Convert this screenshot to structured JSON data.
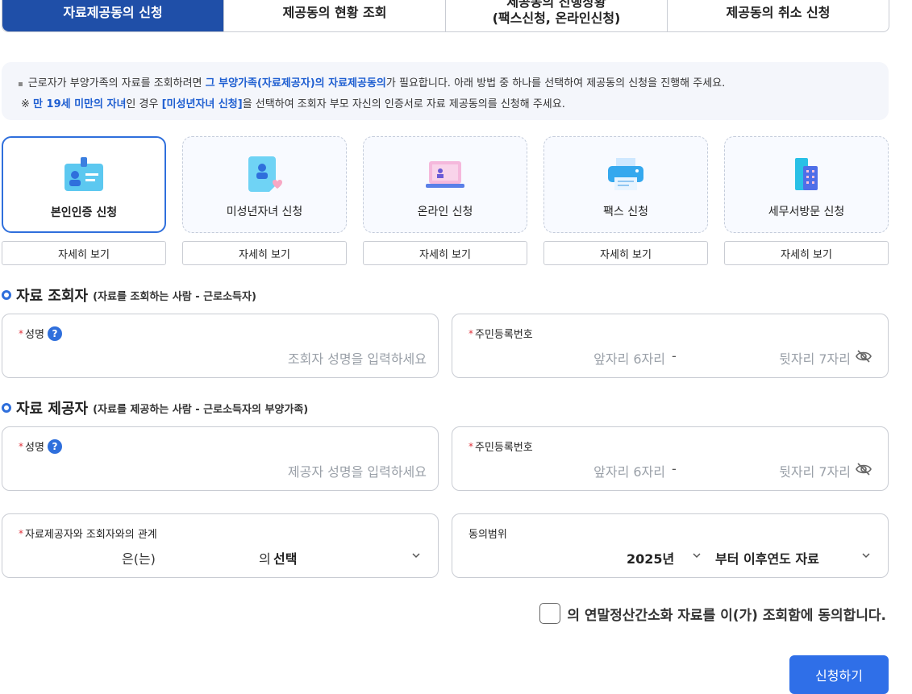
{
  "tabs": [
    {
      "label": "자료제공동의 신청",
      "active": true
    },
    {
      "label": "제공동의 현황 조회"
    },
    {
      "line1": "제공동의 진행상황",
      "line2": "(팩스신청, 온라인신청)"
    },
    {
      "label": "제공동의 취소 신청"
    }
  ],
  "notice": {
    "l1_a": "근로자가 부양가족의 자료를 조회하려면 ",
    "l1_b": "그 부양가족(자료제공자)의 자료제공동의",
    "l1_c": "가 필요합니다. 아래 방법 중 하나를 선택하여 제공동의 신청을 진행해 주세요.",
    "l2_a": "※ ",
    "l2_b": "만 19세 미만의 자녀",
    "l2_c": "인 경우 ",
    "l2_d": "[미성년자녀 신청]",
    "l2_e": "을 선택하여 조회자 부모 자신의 인증서로 자료 제공동의를 신청해 주세요."
  },
  "methods": [
    {
      "label": "본인인증 신청",
      "icon": "id-card-icon",
      "active": true
    },
    {
      "label": "미성년자녀 신청",
      "icon": "child-document-icon"
    },
    {
      "label": "온라인 신청",
      "icon": "laptop-icon"
    },
    {
      "label": "팩스 신청",
      "icon": "fax-printer-icon"
    },
    {
      "label": "세무서방문 신청",
      "icon": "building-icon"
    }
  ],
  "detail_label": "자세히 보기",
  "inquirer": {
    "title": "자료 조회자",
    "sub": "(자료를 조회하는 사람 - 근로소득자)",
    "name_label": "성명",
    "name_placeholder": "조회자 성명을 입력하세요",
    "rrn_label": "주민등록번호",
    "rrn_front": "앞자리 6자리",
    "rrn_dash": "-",
    "rrn_back": "뒷자리 7자리"
  },
  "provider": {
    "title": "자료 제공자",
    "sub": "(자료를 제공하는 사람 - 근로소득자의 부양가족)",
    "name_label": "성명",
    "name_placeholder": "제공자 성명을 입력하세요",
    "rrn_label": "주민등록번호",
    "rrn_front": "앞자리 6자리",
    "rrn_dash": "-",
    "rrn_back": "뒷자리 7자리"
  },
  "relation": {
    "label": "자료제공자와 조회자와의 관계",
    "text_a": "은(는)",
    "text_b": "의",
    "select_value": "선택"
  },
  "scope": {
    "label": "동의범위",
    "year": "2025년",
    "range": "부터 이후연도 자료"
  },
  "agreement_text": "의 연말정산간소화 자료를 이(가) 조회함에 동의합니다.",
  "required_mark": "*",
  "help_mark": "?",
  "submit_label": "신청하기",
  "colors": {
    "primary": "#2f6fdc",
    "active_tab": "#1f4fa8",
    "required": "#e0323b"
  }
}
